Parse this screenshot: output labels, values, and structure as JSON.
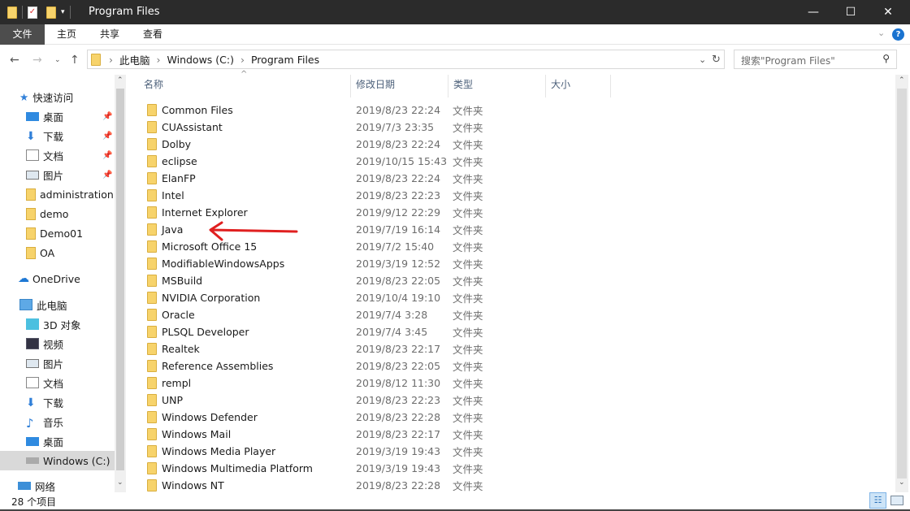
{
  "window": {
    "title": "Program Files",
    "minimize": "—",
    "maximize": "☐",
    "close": "✕"
  },
  "ribbon": {
    "tabs": [
      "文件",
      "主页",
      "共享",
      "查看"
    ],
    "help": "?",
    "expand": "⌄"
  },
  "address": {
    "crumbs": [
      "此电脑",
      "Windows (C:)",
      "Program Files"
    ],
    "search_placeholder": "搜索\"Program Files\""
  },
  "sidebar": {
    "quick_access": "快速访问",
    "quick_items": [
      {
        "label": "桌面",
        "icon": "desktop-icon"
      },
      {
        "label": "下载",
        "icon": "download-icon"
      },
      {
        "label": "文档",
        "icon": "document-icon"
      },
      {
        "label": "图片",
        "icon": "picture-icon"
      },
      {
        "label": "administration",
        "icon": "folder-icon"
      },
      {
        "label": "demo",
        "icon": "folder-icon"
      },
      {
        "label": "Demo01",
        "icon": "folder-icon"
      },
      {
        "label": "OA",
        "icon": "folder-icon"
      }
    ],
    "onedrive": "OneDrive",
    "this_pc": "此电脑",
    "pc_items": [
      {
        "label": "3D 对象",
        "icon": "3d-objects-icon"
      },
      {
        "label": "视频",
        "icon": "video-icon"
      },
      {
        "label": "图片",
        "icon": "picture-icon"
      },
      {
        "label": "文档",
        "icon": "document-icon"
      },
      {
        "label": "下载",
        "icon": "download-icon"
      },
      {
        "label": "音乐",
        "icon": "music-icon"
      },
      {
        "label": "桌面",
        "icon": "desktop-icon"
      },
      {
        "label": "Windows (C:)",
        "icon": "drive-icon"
      }
    ],
    "network": "网络"
  },
  "columns": {
    "name": "名称",
    "date": "修改日期",
    "type": "类型",
    "size": "大小"
  },
  "files": [
    {
      "name": "Common Files",
      "date": "2019/8/23 22:24",
      "type": "文件夹"
    },
    {
      "name": "CUAssistant",
      "date": "2019/7/3 23:35",
      "type": "文件夹"
    },
    {
      "name": "Dolby",
      "date": "2019/8/23 22:24",
      "type": "文件夹"
    },
    {
      "name": "eclipse",
      "date": "2019/10/15 15:43",
      "type": "文件夹"
    },
    {
      "name": "ElanFP",
      "date": "2019/8/23 22:24",
      "type": "文件夹"
    },
    {
      "name": "Intel",
      "date": "2019/8/23 22:23",
      "type": "文件夹"
    },
    {
      "name": "Internet Explorer",
      "date": "2019/9/12 22:29",
      "type": "文件夹"
    },
    {
      "name": "Java",
      "date": "2019/7/19 16:14",
      "type": "文件夹"
    },
    {
      "name": "Microsoft Office 15",
      "date": "2019/7/2 15:40",
      "type": "文件夹"
    },
    {
      "name": "ModifiableWindowsApps",
      "date": "2019/3/19 12:52",
      "type": "文件夹"
    },
    {
      "name": "MSBuild",
      "date": "2019/8/23 22:05",
      "type": "文件夹"
    },
    {
      "name": "NVIDIA Corporation",
      "date": "2019/10/4 19:10",
      "type": "文件夹"
    },
    {
      "name": "Oracle",
      "date": "2019/7/4 3:28",
      "type": "文件夹"
    },
    {
      "name": "PLSQL Developer",
      "date": "2019/7/4 3:45",
      "type": "文件夹"
    },
    {
      "name": "Realtek",
      "date": "2019/8/23 22:17",
      "type": "文件夹"
    },
    {
      "name": "Reference Assemblies",
      "date": "2019/8/23 22:05",
      "type": "文件夹"
    },
    {
      "name": "rempl",
      "date": "2019/8/12 11:30",
      "type": "文件夹"
    },
    {
      "name": "UNP",
      "date": "2019/8/23 22:23",
      "type": "文件夹"
    },
    {
      "name": "Windows Defender",
      "date": "2019/8/23 22:28",
      "type": "文件夹"
    },
    {
      "name": "Windows Mail",
      "date": "2019/8/23 22:17",
      "type": "文件夹"
    },
    {
      "name": "Windows Media Player",
      "date": "2019/3/19 19:43",
      "type": "文件夹"
    },
    {
      "name": "Windows Multimedia Platform",
      "date": "2019/3/19 19:43",
      "type": "文件夹"
    },
    {
      "name": "Windows NT",
      "date": "2019/8/23 22:28",
      "type": "文件夹"
    }
  ],
  "status": {
    "count": "28 个项目"
  },
  "colors": {
    "annotation_arrow": "#e02020",
    "selected": "#d9d9d9",
    "titlebar": "#2b2b2b"
  }
}
